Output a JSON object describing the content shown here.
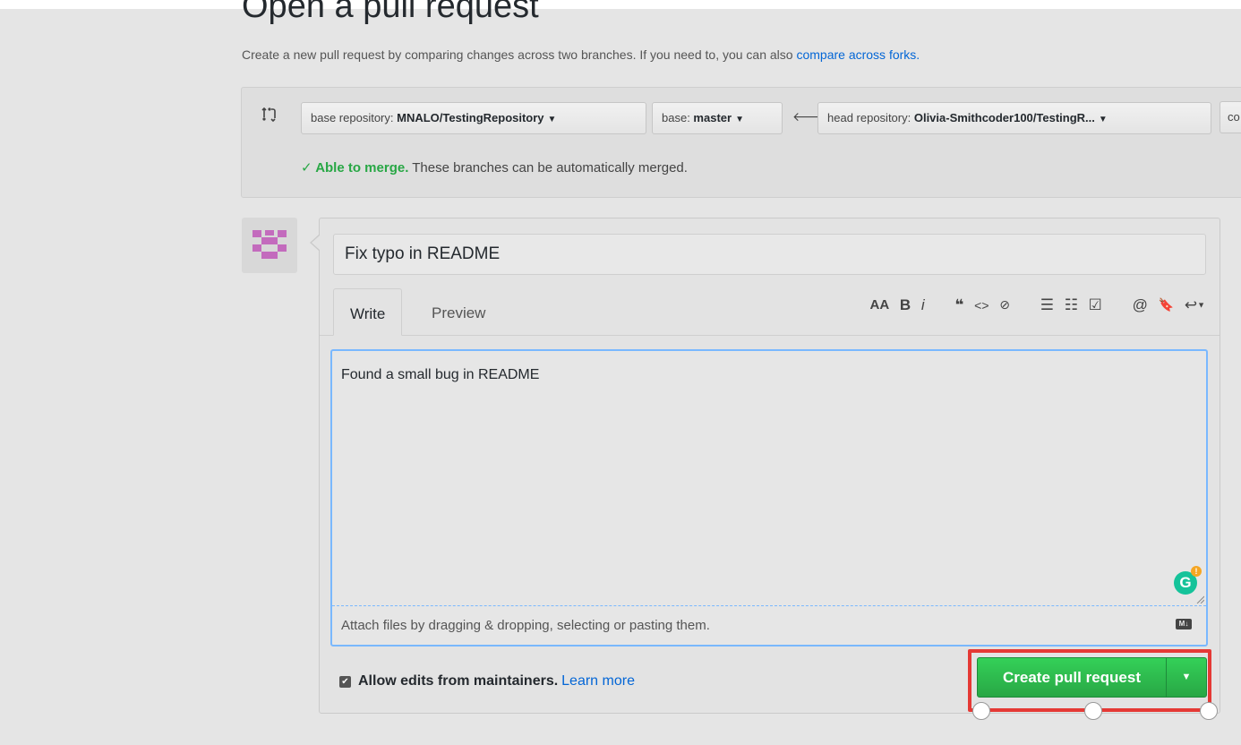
{
  "header": {
    "title": "Open a pull request",
    "subtitle": "Create a new pull request by comparing changes across two branches. If you need to, you can also ",
    "subtitle_link": "compare across forks."
  },
  "compare": {
    "base_repo_label": "base repository: ",
    "base_repo_value": "MNALO/TestingRepository",
    "base_label": "base: ",
    "base_value": "master",
    "head_repo_label": "head repository: ",
    "head_repo_value": "Olivia-Smithcoder100/TestingR...",
    "compare_partial": "co",
    "merge_ok": "Able to merge.",
    "merge_text": " These branches can be automatically merged."
  },
  "form": {
    "title_value": "Fix typo in README",
    "tabs": [
      {
        "label": "Write"
      },
      {
        "label": "Preview"
      }
    ],
    "body_value": "Found a small bug in README",
    "attach_hint": "Attach files by dragging & dropping, selecting or pasting them.",
    "markdown_badge": "M↓",
    "allow_edits_label": "Allow edits from maintainers.",
    "learn_more": "Learn more",
    "create_button": "Create pull request"
  },
  "toolbar": {
    "items": [
      "AA",
      "B",
      "i",
      "❝",
      "<>",
      "⊘",
      "☰",
      "☷",
      "☑",
      "@",
      "🔖",
      "↩"
    ]
  },
  "colors": {
    "accent_green": "#28a745",
    "link_blue": "#0366d6",
    "highlight_red": "#e53935"
  }
}
